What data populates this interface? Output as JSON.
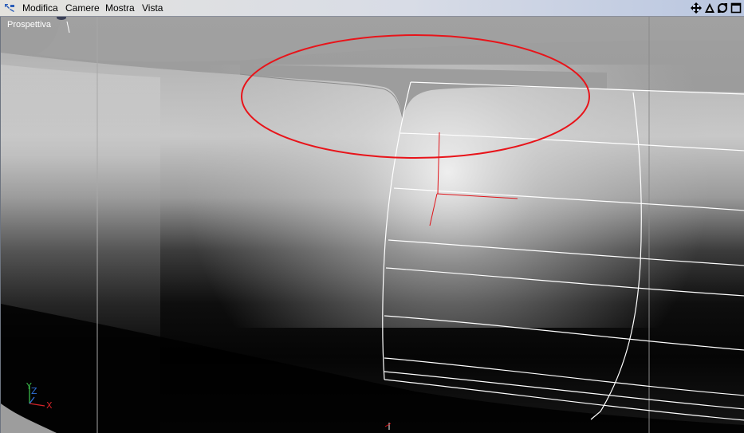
{
  "menubar": {
    "items": [
      {
        "label": "Modifica"
      },
      {
        "label": "Camere"
      },
      {
        "label": "Mostra"
      },
      {
        "label": "Vista"
      }
    ],
    "icons": [
      "app-icon",
      "move-view-icon",
      "rotate-view-icon",
      "zoom-view-icon",
      "maximize-view-icon"
    ]
  },
  "viewport": {
    "label": "Prospettiva",
    "highlight_color": "#e8141a",
    "wire_color": "#ffffff"
  },
  "axes": {
    "x": "X",
    "y": "Y",
    "z": "Z",
    "x_color": "#d4242a",
    "y_color": "#3bb84a",
    "z_color": "#2f6fd6"
  }
}
